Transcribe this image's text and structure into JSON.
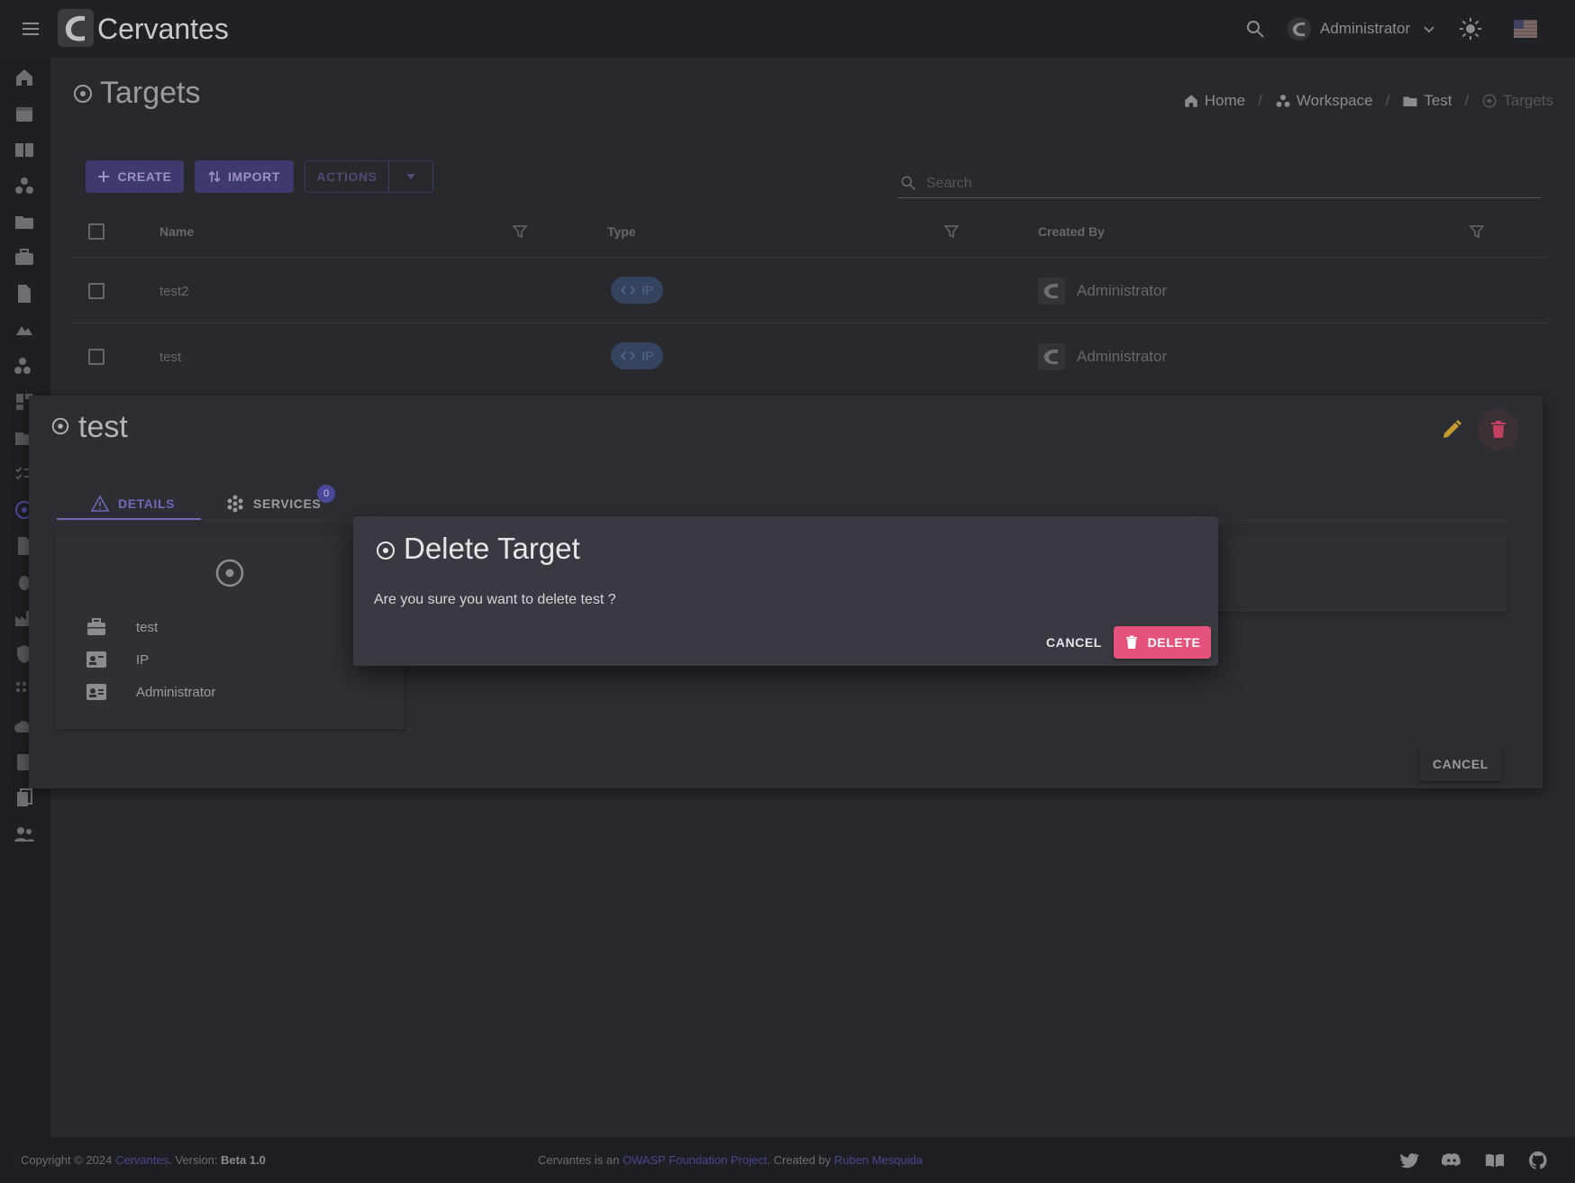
{
  "app": {
    "brand": "Cervantes",
    "user": "Administrator"
  },
  "page": {
    "title": "Targets"
  },
  "breadcrumb": [
    {
      "label": "Home",
      "icon": "home-icon"
    },
    {
      "label": "Workspace",
      "icon": "workspace-icon"
    },
    {
      "label": "Test",
      "icon": "folder-icon"
    },
    {
      "label": "Targets",
      "icon": "target-icon"
    }
  ],
  "toolbar": {
    "create": "CREATE",
    "import": "IMPORT",
    "actions": "ACTIONS",
    "search_placeholder": "Search"
  },
  "table": {
    "columns": [
      "Name",
      "Type",
      "Created By"
    ],
    "rows": [
      {
        "name": "test2",
        "type": "IP",
        "created_by": "Administrator"
      },
      {
        "name": "test",
        "type": "IP",
        "created_by": "Administrator"
      }
    ]
  },
  "detail": {
    "title": "test",
    "tabs": [
      {
        "label": "DETAILS"
      },
      {
        "label": "SERVICES",
        "badge": "0"
      }
    ],
    "fields": [
      {
        "icon": "briefcase-icon",
        "value": "test"
      },
      {
        "icon": "id-card-icon",
        "value": "IP"
      },
      {
        "icon": "contact-card-icon",
        "value": "Administrator"
      }
    ],
    "cancel": "CANCEL"
  },
  "dialog": {
    "title": "Delete Target",
    "message": "Are you sure you want to delete test ?",
    "cancel": "CANCEL",
    "confirm": "DELETE"
  },
  "footer": {
    "copyright": "Copyright © 2024 ",
    "brand_link": "Cervantes",
    "version_label": ". Version: ",
    "version": "Beta 1.0",
    "owasp_prefix": "Cervantes is an ",
    "owasp_link": "OWASP Foundation Project",
    "created_by": ". Created by ",
    "author_link": "Ruben Mesquida"
  },
  "colors": {
    "accent": "#6e69b8",
    "danger": "#e5537c",
    "edit": "#c49a2c",
    "background": "#202124"
  }
}
